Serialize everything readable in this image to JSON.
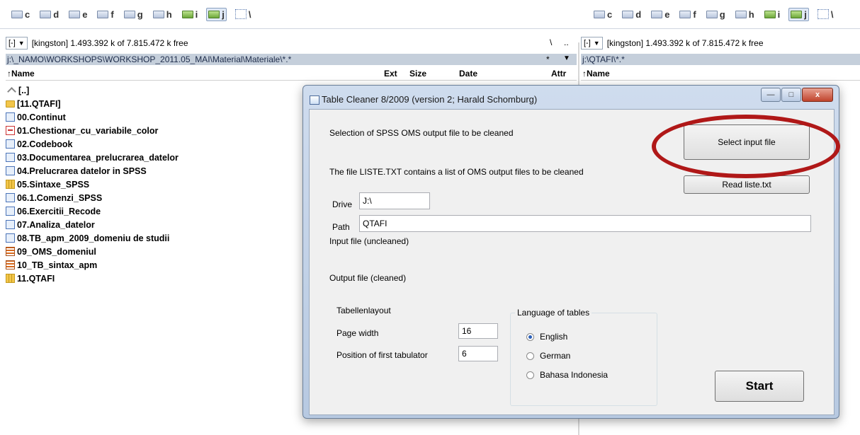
{
  "left_panel": {
    "drives": [
      "c",
      "d",
      "e",
      "f",
      "g",
      "h",
      "i",
      "j"
    ],
    "root_label": "\\",
    "view_combo": "[-]",
    "drive_info": "[kingston]  1.493.392 k of 7.815.472 k free",
    "nav_root": "\\",
    "nav_up": "..",
    "path": "j:\\_NAMO\\WORKSHOPS\\WORKSHOP_2011.05_MAI\\Material\\Materiale\\*.*",
    "filter_star": "*",
    "filter_arrow": "▼",
    "columns": [
      "↑Name",
      "Ext",
      "Size",
      "Date",
      "Attr"
    ],
    "files": [
      {
        "name": "[..]",
        "icon": "up-icon"
      },
      {
        "name": "[11.QTAFI]",
        "icon": "folder-icon"
      },
      {
        "name": "00.Continut",
        "icon": "word-icon"
      },
      {
        "name": "01.Chestionar_cu_variabile_color",
        "icon": "pdf-icon"
      },
      {
        "name": "02.Codebook",
        "icon": "word-icon"
      },
      {
        "name": "03.Documentarea_prelucrarea_datelor",
        "icon": "word-icon"
      },
      {
        "name": "04.Prelucrarea datelor in SPSS",
        "icon": "word-icon"
      },
      {
        "name": "05.Sintaxe_SPSS",
        "icon": "grid-icon"
      },
      {
        "name": "06.1.Comenzi_SPSS",
        "icon": "word-icon"
      },
      {
        "name": "06.Exercitii_Recode",
        "icon": "word-icon"
      },
      {
        "name": "07.Analiza_datelor",
        "icon": "word-icon"
      },
      {
        "name": "08.TB_apm_2009_domeniu de studii",
        "icon": "word-icon"
      },
      {
        "name": "09_OMS_domeniul",
        "icon": "spss-icon"
      },
      {
        "name": "10_TB_sintax_apm",
        "icon": "spss-icon"
      },
      {
        "name": "11.QTAFI",
        "icon": "grid-icon"
      }
    ]
  },
  "right_panel": {
    "drives": [
      "c",
      "d",
      "e",
      "f",
      "g",
      "h",
      "i",
      "j"
    ],
    "root_label": "\\",
    "view_combo": "[-]",
    "drive_info": "[kingston]  1.493.392 k of 7.815.472 k free",
    "path": "j:\\QTAFI\\*.*",
    "columns": [
      "↑Name"
    ]
  },
  "dialog": {
    "title": "Table Cleaner 8/2009 (version 2; Harald Schomburg)",
    "minimize": "—",
    "maximize": "□",
    "close": "x",
    "selection_label": "Selection of SPSS OMS output file to be cleaned",
    "select_button": "Select input file",
    "liste_label": "The file LISTE.TXT contains a list of OMS output files to be cleaned",
    "read_button": "Read liste.txt",
    "drive_label": "Drive",
    "drive_value": "J:\\",
    "path_label": "Path",
    "path_value": "QTAFI",
    "input_label": "Input file (uncleaned)",
    "output_label": "Output file (cleaned)",
    "layout_label": "Tabellenlayout",
    "page_width_label": "Page width",
    "page_width_value": "16",
    "tab_label": "Position of first tabulator",
    "tab_value": "6",
    "lang_group": "Language of tables",
    "languages": [
      {
        "label": "English",
        "selected": true
      },
      {
        "label": "German",
        "selected": false
      },
      {
        "label": "Bahasa Indonesia",
        "selected": false
      }
    ],
    "start_button": "Start"
  },
  "annotation_color": "#b01818"
}
